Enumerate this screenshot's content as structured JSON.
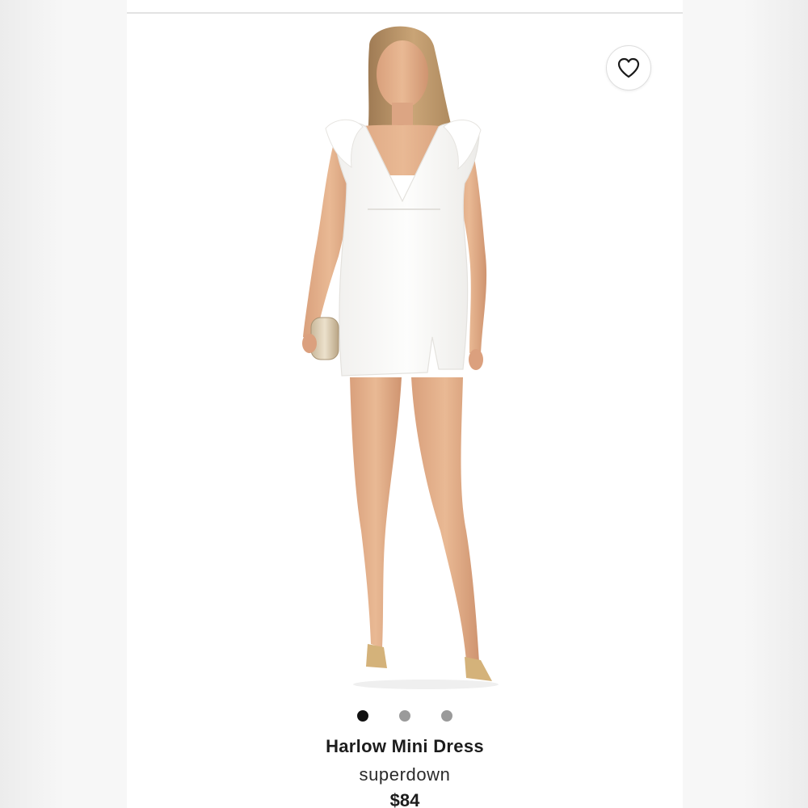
{
  "product": {
    "name": "Harlow Mini Dress",
    "brand": "superdown",
    "price": "$84",
    "image": {
      "subject": "model-in-white-mini-dress",
      "slides_total": 3,
      "active_slide": 1
    }
  },
  "actions": {
    "favorite_icon": "heart-outline-icon"
  },
  "colors": {
    "dress": "#fbfbfa",
    "background": "#ffffff",
    "dot_active": "#111111",
    "dot_inactive": "#9a9a9a"
  }
}
